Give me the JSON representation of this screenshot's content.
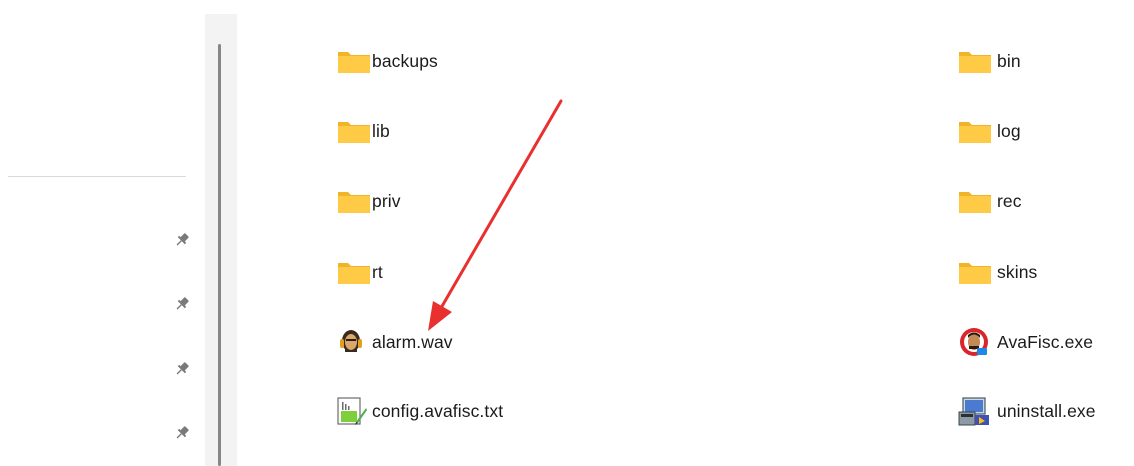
{
  "navigation_pane": {
    "pins": [
      {
        "icon": "pin-icon"
      },
      {
        "icon": "pin-icon"
      },
      {
        "icon": "pin-icon"
      },
      {
        "icon": "pin-icon"
      }
    ]
  },
  "files": {
    "column_left": [
      {
        "name": "backups",
        "type": "folder",
        "icon": "folder-icon"
      },
      {
        "name": "lib",
        "type": "folder",
        "icon": "folder-icon"
      },
      {
        "name": "priv",
        "type": "folder",
        "icon": "folder-icon"
      },
      {
        "name": "rt",
        "type": "folder",
        "icon": "folder-icon"
      },
      {
        "name": "alarm.wav",
        "type": "audio",
        "icon": "audio-file-icon"
      },
      {
        "name": "config.avafisc.txt",
        "type": "text",
        "icon": "text-file-icon"
      }
    ],
    "column_right": [
      {
        "name": "bin",
        "type": "folder",
        "icon": "folder-icon"
      },
      {
        "name": "log",
        "type": "folder",
        "icon": "folder-icon"
      },
      {
        "name": "rec",
        "type": "folder",
        "icon": "folder-icon"
      },
      {
        "name": "skins",
        "type": "folder",
        "icon": "folder-icon"
      },
      {
        "name": "AvaFisc.exe",
        "type": "application",
        "icon": "app-exe-icon"
      },
      {
        "name": "uninstall.exe",
        "type": "application",
        "icon": "installer-exe-icon"
      }
    ]
  },
  "annotation": {
    "type": "arrow",
    "color": "#e8302f",
    "points_to": "alarm.wav"
  },
  "colors": {
    "folder": "#ffca45",
    "folder_back": "#f0b429",
    "arrow": "#e8302f"
  }
}
